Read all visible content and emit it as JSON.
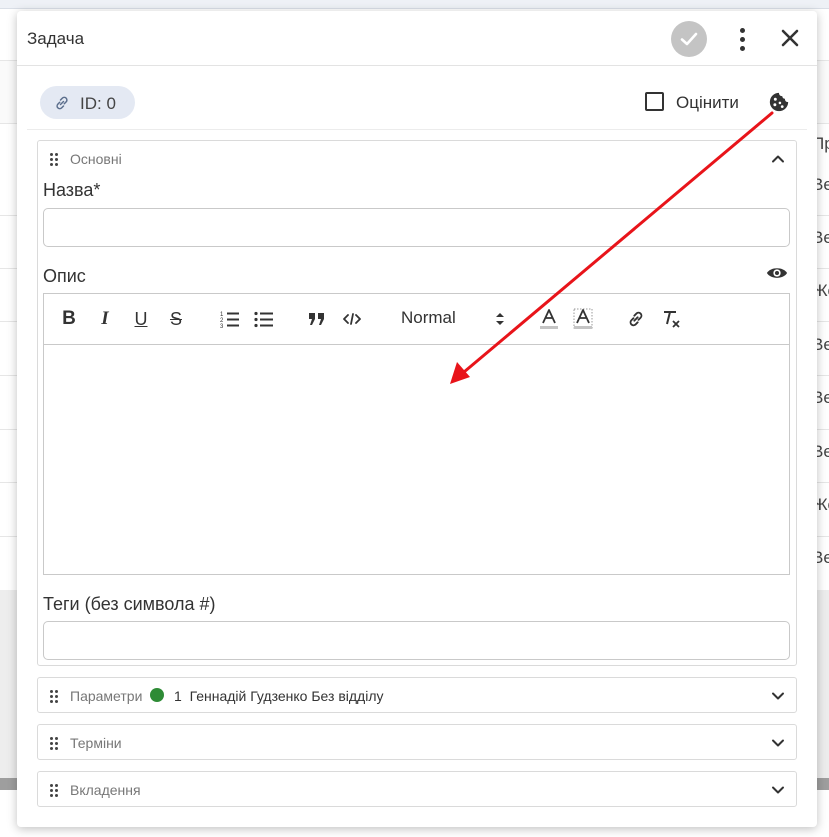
{
  "background": {
    "right_column_cells": [
      "Пр",
      "Ве",
      "Ве",
      "Же",
      "Ве",
      "Ве",
      "Ве",
      "Же",
      "Ве"
    ]
  },
  "modal": {
    "title": "Задача",
    "header_icons": [
      "check-icon",
      "more-vertical-icon",
      "close-icon"
    ],
    "id_chip": {
      "icon": "link-icon",
      "label": "ID: 0"
    },
    "rate": {
      "label": "Оцінити",
      "checked": false
    },
    "cookie_icon": "cookie-icon"
  },
  "main_section": {
    "title": "Основні",
    "expanded": true,
    "name_field": {
      "label": "Назва*",
      "value": ""
    },
    "description": {
      "label": "Опис",
      "toolbar": {
        "bold": "B",
        "italic": "I",
        "underline": "U",
        "strike": "S",
        "format_select": "Normal"
      },
      "content": ""
    },
    "tags_field": {
      "label": "Теги (без символа #)",
      "value": ""
    }
  },
  "params_section": {
    "title": "Параметри",
    "status_color": "#2e8b36",
    "count": "1",
    "assignee": "Геннадій Гудзенко",
    "department": "Без відділу"
  },
  "terms_section": {
    "title": "Терміни"
  },
  "attachments_section": {
    "title": "Вкладення"
  },
  "annotation": {
    "arrow_color": "#e8141a"
  }
}
